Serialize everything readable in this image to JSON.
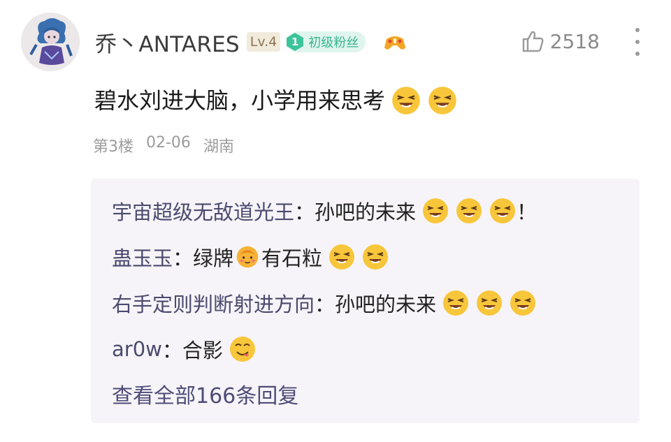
{
  "comment": {
    "username": "乔丶ANTARES",
    "level": "Lv.4",
    "fan_badge_level": "1",
    "fan_badge_label": "初级粉丝",
    "medal_icon": "game-controller-medal-icon",
    "likes": "2518",
    "text": "碧水刘进大脑，小学用来思考",
    "floor": "第3楼",
    "date": "02-06",
    "location": "湖南"
  },
  "replies": [
    {
      "author": "宇宙超级无敌道光王",
      "separator": "：",
      "text": "孙吧的未来",
      "suffix": "！"
    },
    {
      "author": "蛊玉玉",
      "separator": "：",
      "text_before": "绿牌",
      "text_after": "有石粒"
    },
    {
      "author": "右手定则判断射进方向",
      "separator": "：",
      "text": "孙吧的未来"
    },
    {
      "author": "ar0w",
      "separator": "：",
      "text": "合影"
    }
  ],
  "view_all": "查看全部166条回复",
  "colors": {
    "reply_author": "#4b4a6e",
    "view_all": "#4e4c78",
    "fan_badge": "#36b58e",
    "replies_background": "#f6f4f8"
  }
}
